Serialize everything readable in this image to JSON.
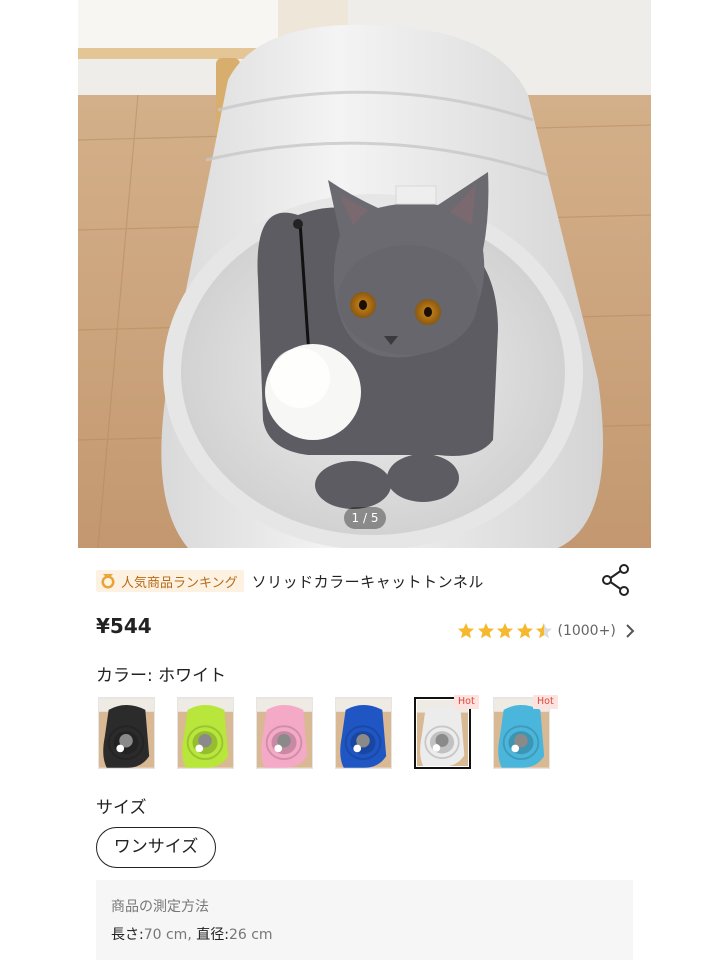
{
  "gallery": {
    "pager": "1 / 5",
    "main_image": "gray cat lying inside white collapsible tunnel with hanging pompom toy"
  },
  "product": {
    "ranking_badge": "人気商品ランキング",
    "title": "ソリッドカラーキャットトンネル",
    "price": "¥544",
    "rating_value": 4.5,
    "rating_count": "(1000+)"
  },
  "color_section": {
    "label": "カラー: ホワイト",
    "swatches": [
      {
        "color": "#2b2b2b",
        "hot": ""
      },
      {
        "color": "#b8e63a",
        "hot": ""
      },
      {
        "color": "#f4a9c6",
        "hot": ""
      },
      {
        "color": "#1f56c4",
        "hot": ""
      },
      {
        "color": "#ececec",
        "hot": "Hot",
        "selected": true
      },
      {
        "color": "#4bb6dc",
        "hot": "Hot"
      }
    ]
  },
  "size_section": {
    "label": "サイズ",
    "option": "ワンサイズ"
  },
  "measurement": {
    "heading": "商品の測定方法",
    "length_label": "長さ:",
    "length_value": "70 cm, ",
    "diameter_label": "直径:",
    "diameter_value": "26 cm"
  },
  "colors": {
    "star": "#f5b82e",
    "badge_text": "#b66a17",
    "hot_text": "#e0463a"
  },
  "icons": {
    "share": "share-icon",
    "medal": "medal-icon",
    "chevron": "chevron-right-icon",
    "star": "star-icon"
  }
}
